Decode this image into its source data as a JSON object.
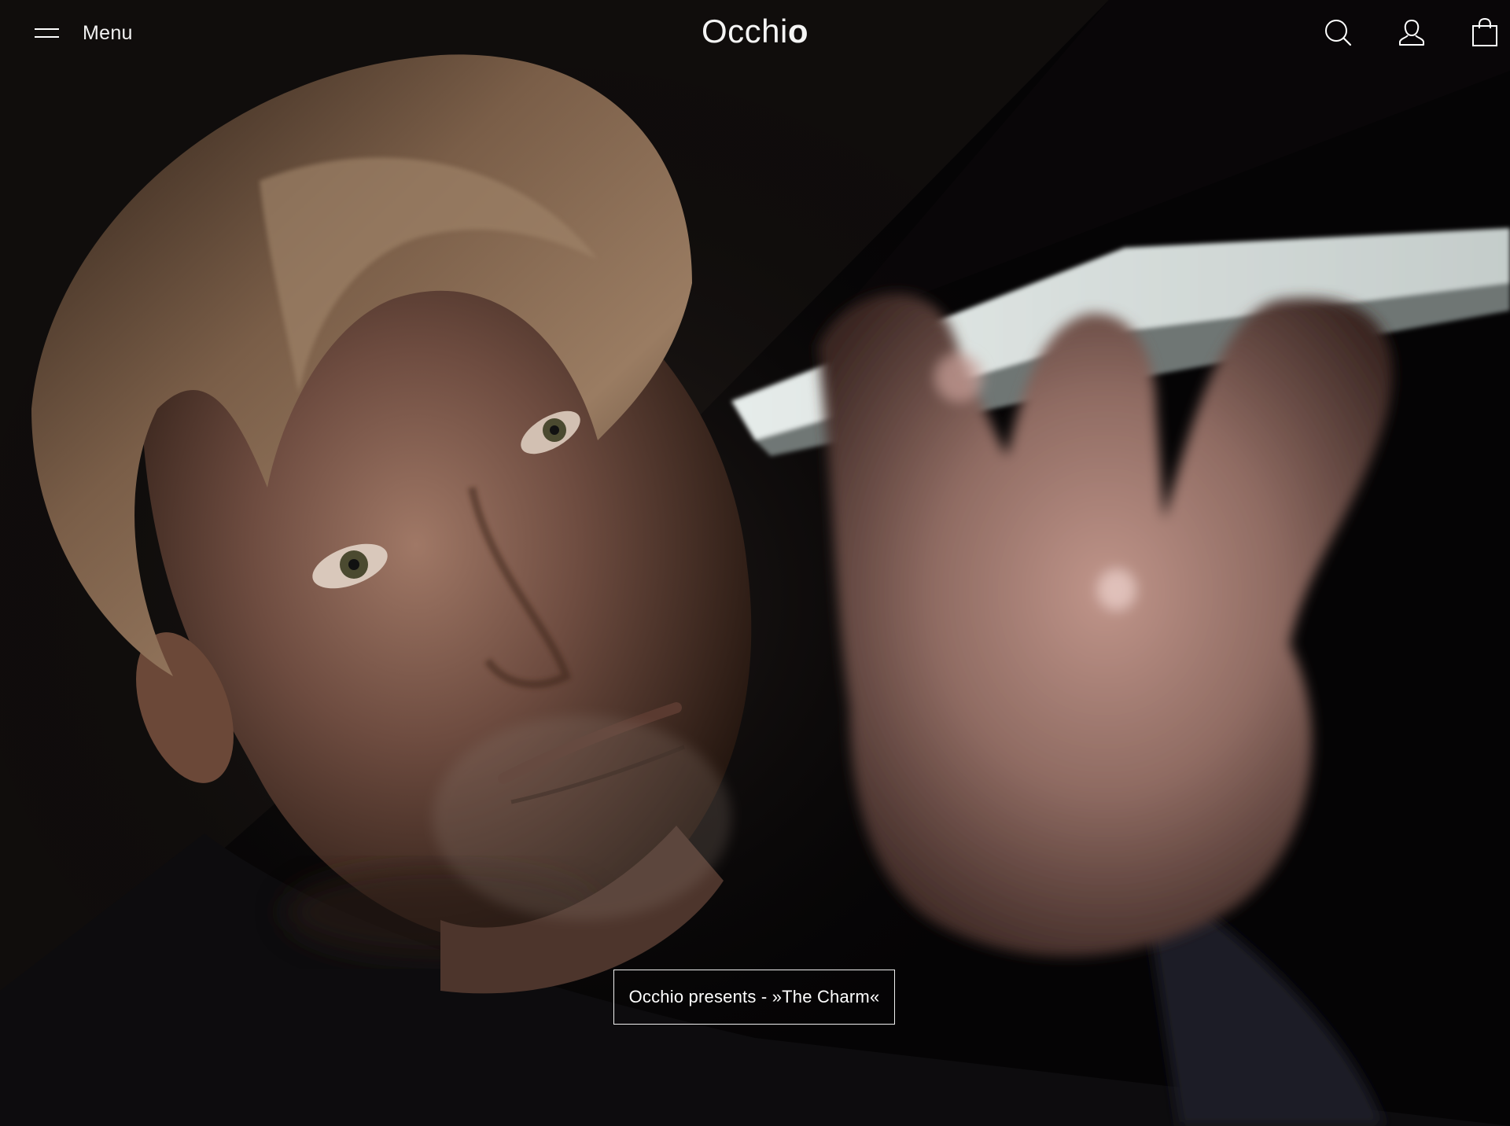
{
  "header": {
    "menu_label": "Menu",
    "logo_light": "Occhi",
    "logo_bold": "o"
  },
  "icons": {
    "menu": "hamburger-icon",
    "search": "search-icon",
    "account": "user-icon",
    "cart": "shopping-bag-icon"
  },
  "hero": {
    "cta_label": "Occhio presents - »The Charm«"
  },
  "colors": {
    "background": "#000000",
    "text": "#ffffff"
  }
}
